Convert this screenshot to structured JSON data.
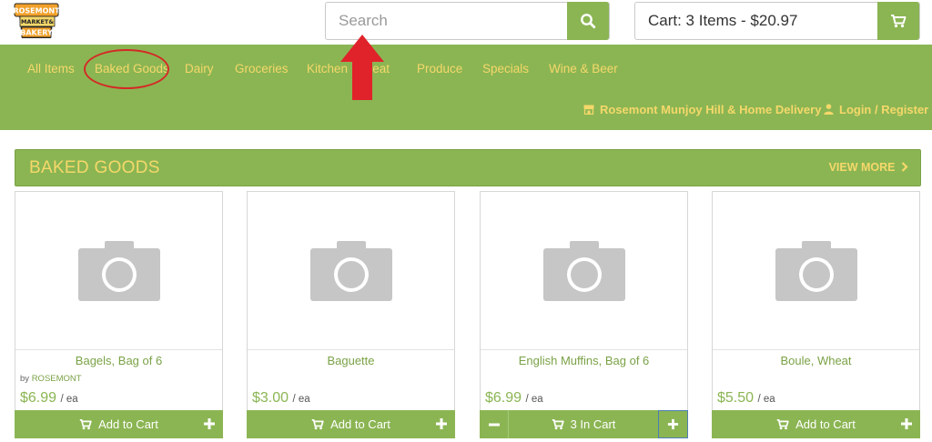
{
  "logo": {
    "line1": "ROSEMONT",
    "line2": "MARKET&",
    "line3": "BAKERY"
  },
  "search": {
    "placeholder": "Search"
  },
  "cart": {
    "label": "Cart: 3 Items - $20.97"
  },
  "nav": {
    "categories": [
      "All Items",
      "Baked Goods",
      "Dairy",
      "Groceries",
      "Kitchen",
      "Meat",
      "Produce",
      "Specials",
      "Wine & Beer"
    ],
    "store": "Rosemont Munjoy Hill & Home Delivery",
    "login": "Login / Register"
  },
  "section": {
    "title": "BAKED GOODS",
    "view_more": "VIEW MORE"
  },
  "products": [
    {
      "name": "Bagels, Bag of 6",
      "by_prefix": "by",
      "brand": "ROSEMONT",
      "price": "$6.99",
      "unit": "/ ea",
      "button": "Add to Cart"
    },
    {
      "name": "Baguette",
      "price": "$3.00",
      "unit": "/ ea",
      "button": "Add to Cart"
    },
    {
      "name": "English Muffins, Bag of 6",
      "price": "$6.99",
      "unit": "/ ea",
      "button": "3 In Cart"
    },
    {
      "name": "Boule, Wheat",
      "price": "$5.50",
      "unit": "/ ea",
      "button": "Add to Cart"
    }
  ],
  "colors": {
    "brand_green": "#8bb553",
    "accent_yellow": "#f5d86a",
    "annotation_red": "#d42a26"
  },
  "icons": [
    "search-icon",
    "cart-icon",
    "store-icon",
    "user-icon",
    "chevron-right-icon",
    "camera-placeholder-icon",
    "plus-icon",
    "minus-icon"
  ]
}
